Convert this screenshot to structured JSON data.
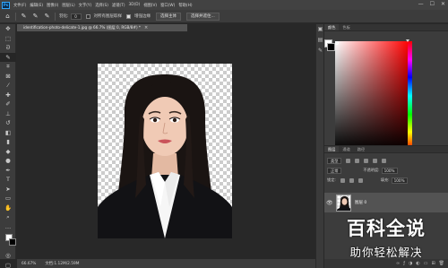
{
  "app": {
    "logo": "Ps",
    "menu": [
      "文件(F)",
      "编辑(E)",
      "图像(I)",
      "图层(L)",
      "文字(Y)",
      "选择(S)",
      "滤镜(T)",
      "3D(D)",
      "视图(V)",
      "窗口(W)",
      "帮助(H)"
    ],
    "window_controls": [
      "—",
      "☐",
      "✕"
    ]
  },
  "options_bar": {
    "feather_label": "羽化:",
    "feather_value": "0",
    "sample_all_layers": "对所有图层取样",
    "auto_enhance": "增强边缘",
    "select_subject": "选择主体",
    "select_and_mask": "选择并遮住..."
  },
  "document": {
    "tab_label": "identification-photo-delicate-1.jpg @ 66.7% (图层 0, RGB/8#) *",
    "close": "×",
    "zoom": "66.67%",
    "doc_info": "文档:1.12M/2.59M"
  },
  "tools": [
    "move-tool",
    "marquee-tool",
    "lasso-tool",
    "quick-select-tool",
    "crop-tool",
    "eyedropper-tool",
    "healing-tool",
    "brush-tool",
    "stamp-tool",
    "history-brush-tool",
    "eraser-tool",
    "gradient-tool",
    "blur-tool",
    "dodge-tool",
    "pen-tool",
    "type-tool",
    "path-select-tool",
    "shape-tool",
    "hand-tool",
    "zoom-tool",
    "more-tool"
  ],
  "panels": {
    "color_tabs": [
      "颜色",
      "色板"
    ],
    "layers_tabs": [
      "图层",
      "通道",
      "路径"
    ],
    "kind_label": "类型",
    "blend_mode": "正常",
    "opacity_label": "不透明度:",
    "opacity_value": "100%",
    "lock_label": "锁定:",
    "fill_label": "填充:",
    "fill_value": "100%",
    "layer_name": "图层 0",
    "footer_icons": [
      "link-icon",
      "fx-icon",
      "mask-icon",
      "adjustment-icon",
      "group-icon",
      "new-layer-icon",
      "delete-icon"
    ]
  },
  "watermark": {
    "line1": "百科全说",
    "line2": "助你轻松解决"
  },
  "colors": {
    "foreground": "#000000",
    "background": "#ffffff",
    "accent": "#31a8ff"
  }
}
